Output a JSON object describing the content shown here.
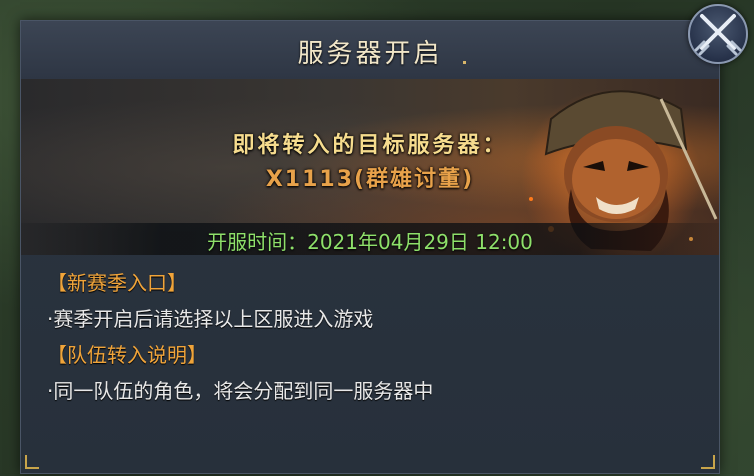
{
  "dialog": {
    "title": "服务器开启",
    "target_server_label": "即将转入的目标服务器：",
    "target_server_name": "X1113(群雄讨董)",
    "open_time": "开服时间：2021年04月29日 12:00",
    "sections": [
      {
        "heading": "【新赛季入口】",
        "body": "·赛季开启后请选择以上区服进入游戏"
      },
      {
        "heading": "【队伍转入说明】",
        "body": "·同一队伍的角色，将会分配到同一服务器中"
      }
    ]
  },
  "icons": {
    "close": "crossed-swords-icon",
    "banner_art": "warrior-portrait-icon"
  },
  "colors": {
    "title": "#f1e6c8",
    "banner_label": "#f6dc8e",
    "server_name": "#e8a24a",
    "open_time": "#8ee06a",
    "heading": "#f0a43a"
  }
}
